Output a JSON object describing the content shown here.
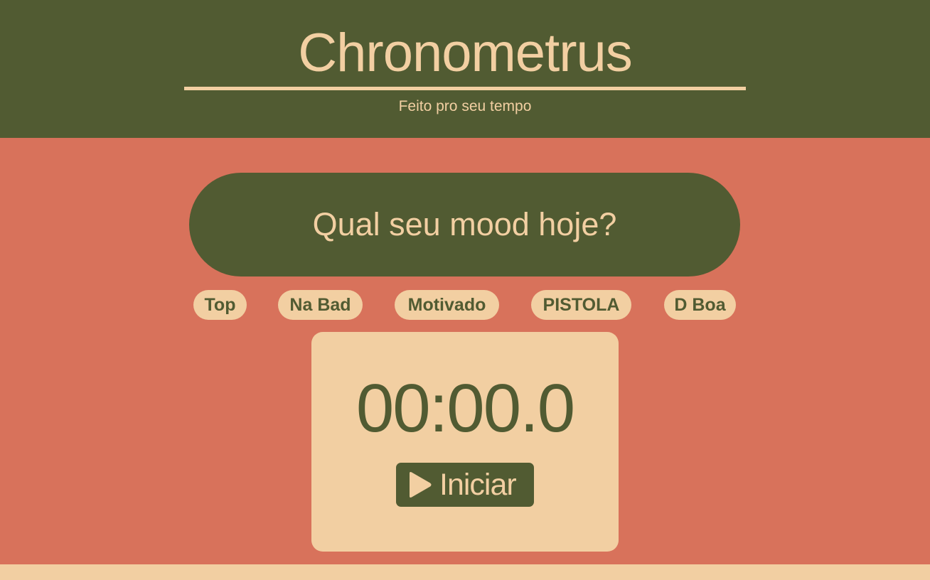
{
  "header": {
    "title": "Chronometrus",
    "subtitle": "Feito pro seu tempo"
  },
  "mood": {
    "question": "Qual seu mood hoje?",
    "options": [
      {
        "label": "Top"
      },
      {
        "label": "Na Bad"
      },
      {
        "label": "Motivado"
      },
      {
        "label": "PISTOLA"
      },
      {
        "label": "D Boa"
      }
    ]
  },
  "timer": {
    "display": "00:00.0",
    "start_label": "Iniciar",
    "start_icon": "play-icon"
  },
  "colors": {
    "olive": "#515b32",
    "terracotta": "#d8725b",
    "cream": "#f2cfa2"
  }
}
